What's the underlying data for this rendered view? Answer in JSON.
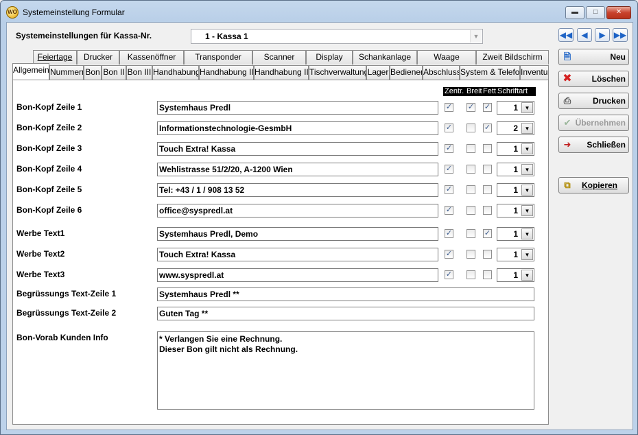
{
  "window": {
    "title": "Systemeinstellung Formular",
    "app_icon_text": "WO"
  },
  "header": {
    "kassa_label": "Systemeinstellungen für Kassa-Nr.",
    "kassa_value": "1 - Kassa 1"
  },
  "tabs_row1": [
    "Feiertage",
    "Drucker",
    "Kassenöffner",
    "Transponder",
    "Scanner",
    "Display",
    "Schankanlage",
    "Waage",
    "Zweit Bildschirm"
  ],
  "tabs_row2": [
    "Allgemein",
    "Nummern",
    "Bon",
    "Bon II",
    "Bon III",
    "Handhabung",
    "Handhabung II",
    "Handhabung III",
    "Tischverwaltung",
    "Lager",
    "Bediener",
    "Abschluss",
    "System & Telefon",
    "Inventur"
  ],
  "columns": {
    "zentr": "Zentr.",
    "breit": "Breit",
    "fett": "Fett",
    "schriftart": "Schriftart"
  },
  "rows": [
    {
      "label": "Bon-Kopf Zeile 1",
      "value": "Systemhaus Predl",
      "zentr": true,
      "breit": true,
      "fett": true,
      "font": "1"
    },
    {
      "label": "Bon-Kopf Zeile 2",
      "value": "Informationstechnologie-GesmbH",
      "zentr": true,
      "breit": false,
      "fett": true,
      "font": "2"
    },
    {
      "label": "Bon-Kopf Zeile 3",
      "value": "Touch Extra! Kassa",
      "zentr": true,
      "breit": false,
      "fett": false,
      "font": "1"
    },
    {
      "label": "Bon-Kopf Zeile 4",
      "value": "Wehlistrasse 51/2/20, A-1200 Wien",
      "zentr": true,
      "breit": false,
      "fett": false,
      "font": "1"
    },
    {
      "label": "Bon-Kopf Zeile 5",
      "value": "Tel: +43 / 1 / 908 13 52",
      "zentr": true,
      "breit": false,
      "fett": false,
      "font": "1"
    },
    {
      "label": "Bon-Kopf Zeile 6",
      "value": "office@syspredl.at",
      "zentr": true,
      "breit": false,
      "fett": false,
      "font": "1"
    },
    {
      "label": "Werbe Text1",
      "value": "Systemhaus Predl, Demo",
      "zentr": true,
      "breit": false,
      "fett": true,
      "font": "1"
    },
    {
      "label": "Werbe Text2",
      "value": "Touch Extra! Kassa",
      "zentr": true,
      "breit": false,
      "fett": false,
      "font": "1"
    },
    {
      "label": "Werbe Text3",
      "value": "www.syspredl.at",
      "zentr": true,
      "breit": false,
      "fett": false,
      "font": "1"
    }
  ],
  "greeting": [
    {
      "label": "Begrüssungs Text-Zeile 1",
      "value": "Systemhaus Predl **"
    },
    {
      "label": "Begrüssungs Text-Zeile 2",
      "value": "Guten Tag **"
    }
  ],
  "memo": {
    "label": "Bon-Vorab Kunden Info",
    "value": "* Verlangen Sie eine Rechnung.\nDieser Bon gilt nicht als Rechnung."
  },
  "side_buttons": {
    "neu": "Neu",
    "loeschen": "Löschen",
    "drucken": "Drucken",
    "uebernehmen": "Übernehmen",
    "schliessen": "Schließen",
    "kopieren": "Kopieren"
  },
  "icons": {
    "first": "first-record-icon",
    "prev": "previous-record-icon",
    "next": "next-record-icon",
    "last": "last-record-icon"
  },
  "colors": {
    "accent_blue": "#1d63c6",
    "delete_red": "#d42020",
    "column_header_bg": "#000000"
  }
}
